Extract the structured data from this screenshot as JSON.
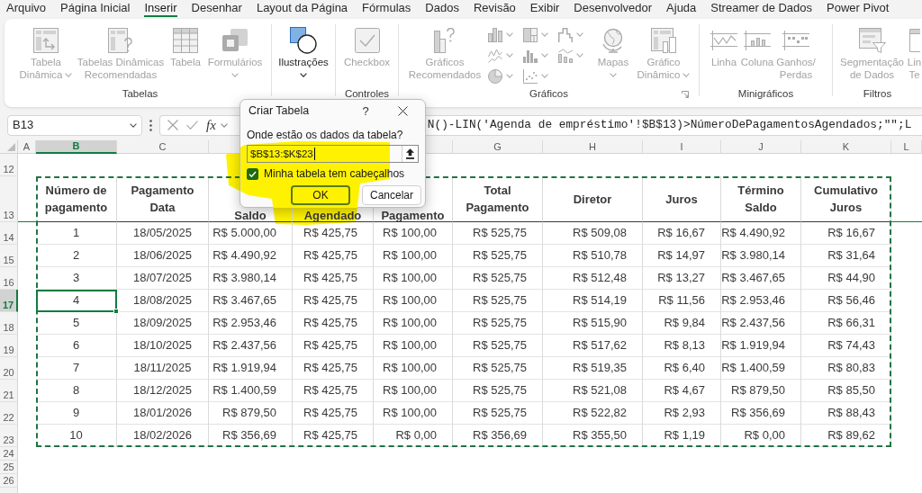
{
  "ribbon_tabs": [
    {
      "label": "Arquivo",
      "selected": false
    },
    {
      "label": "Página Inicial",
      "selected": false
    },
    {
      "label": "Inserir",
      "selected": true
    },
    {
      "label": "Desenhar",
      "selected": false
    },
    {
      "label": "Layout da Página",
      "selected": false
    },
    {
      "label": "Fórmulas",
      "selected": false
    },
    {
      "label": "Dados",
      "selected": false
    },
    {
      "label": "Revisão",
      "selected": false
    },
    {
      "label": "Exibir",
      "selected": false
    },
    {
      "label": "Desenvolvedor",
      "selected": false
    },
    {
      "label": "Ajuda",
      "selected": false
    },
    {
      "label": "Streamer de Dados",
      "selected": false
    },
    {
      "label": "Power Pivot",
      "selected": false
    }
  ],
  "ribbon_groups": [
    {
      "label": "Tabelas",
      "items": [
        {
          "kind": "large",
          "lines": [
            "Tabela",
            "Dinâmica"
          ],
          "disabled": true,
          "dropdown": true
        },
        {
          "kind": "large",
          "lines": [
            "Tabelas Dinâmicas",
            "Recomendadas"
          ],
          "disabled": true,
          "dropdown": false
        },
        {
          "kind": "large",
          "lines": [
            "Tabela"
          ],
          "disabled": true,
          "dropdown": false
        },
        {
          "kind": "large",
          "lines": [
            "Formulários"
          ],
          "disabled": true,
          "dropdown": true
        }
      ]
    },
    {
      "items": [
        {
          "kind": "large",
          "lines": [
            "Ilustrações"
          ],
          "disabled": false,
          "dropdown": true
        }
      ]
    },
    {
      "label": "Controles",
      "items": [
        {
          "kind": "large",
          "lines": [
            "Checkbox"
          ],
          "disabled": true,
          "dropdown": false
        }
      ]
    },
    {
      "label": "Gráficos",
      "launcher": true,
      "items": [
        {
          "kind": "large",
          "lines": [
            "Gráficos",
            "Recomendados"
          ],
          "disabled": true,
          "dropdown": false
        },
        {
          "kind": "chart_grid",
          "buttons": [
            {
              "disabled": true,
              "dropdown": true
            },
            {
              "disabled": true,
              "dropdown": true
            },
            {
              "disabled": true,
              "dropdown": true
            },
            {
              "disabled": true,
              "dropdown": true
            },
            {
              "disabled": true,
              "dropdown": true
            },
            {
              "disabled": true,
              "dropdown": true
            },
            {
              "disabled": true,
              "dropdown": true
            },
            {
              "disabled": true,
              "dropdown": true
            }
          ]
        },
        {
          "kind": "large",
          "lines": [
            "Mapas"
          ],
          "disabled": true,
          "dropdown": true
        },
        {
          "kind": "large",
          "lines": [
            "Gráfico",
            "Dinâmico"
          ],
          "disabled": true,
          "dropdown": true
        }
      ]
    },
    {
      "label": "Minigráficos",
      "items": [
        {
          "kind": "large",
          "lines": [
            "Linha"
          ],
          "disabled": true,
          "dropdown": false
        },
        {
          "kind": "large",
          "lines": [
            "Coluna"
          ],
          "disabled": true,
          "dropdown": false
        },
        {
          "kind": "large",
          "lines": [
            "Ganhos/",
            "Perdas"
          ],
          "disabled": true,
          "dropdown": false
        }
      ]
    },
    {
      "label": "Filtros",
      "items": [
        {
          "kind": "large",
          "lines": [
            "Segmentação",
            "de Dados"
          ],
          "disabled": true,
          "dropdown": false
        },
        {
          "kind": "large",
          "lines": [
            "Lin",
            "Te"
          ],
          "disabled": true,
          "dropdown": false
        }
      ]
    }
  ],
  "formula_bar": {
    "name_box": "B13",
    "function_label": "fx",
    "formula": "N()-LIN('Agenda de empréstimo'!$B$13)>NúmeroDePagamentosAgendados;\"\";L"
  },
  "sheet": {
    "column_headers_left": [
      {
        "label": "A",
        "selected": false
      },
      {
        "label": "B",
        "selected": true
      },
      {
        "label": "C",
        "selected": false
      },
      {
        "selected": false
      }
    ],
    "column_headers_right": [
      {
        "selected": false
      },
      {
        "label": "G",
        "selected": false
      },
      {
        "label": "H",
        "selected": false
      },
      {
        "label": "I",
        "selected": false
      },
      {
        "label": "J",
        "selected": false
      },
      {
        "label": "K",
        "selected": false
      },
      {
        "label": "L",
        "selected": false
      }
    ],
    "row_headers": [
      {
        "label": "12",
        "selected": false
      },
      {
        "label": "13",
        "selected": false
      },
      {
        "label": "14",
        "selected": false
      },
      {
        "label": "15",
        "selected": false
      },
      {
        "label": "16",
        "selected": false
      },
      {
        "label": "17",
        "selected": true
      },
      {
        "label": "18",
        "selected": false
      },
      {
        "label": "19",
        "selected": false
      },
      {
        "label": "20",
        "selected": false
      },
      {
        "label": "21",
        "selected": false
      },
      {
        "label": "22",
        "selected": false
      },
      {
        "label": "23",
        "selected": false
      },
      {
        "label": "24",
        "selected": false
      },
      {
        "label": "25",
        "selected": false
      },
      {
        "label": "26",
        "selected": false
      }
    ]
  },
  "table": {
    "columns": [
      {
        "lines": [
          "Número de",
          "pagamento"
        ],
        "kind": "full"
      },
      {
        "lines": [
          "Pagamento",
          "Data"
        ],
        "kind": "full"
      },
      {
        "lines": [
          "Saldo"
        ],
        "kind": "partly_hidden"
      },
      {
        "lines": [
          "Agendado"
        ],
        "kind": "partly_hidden"
      },
      {
        "lines": [
          "Pagamento"
        ],
        "kind": "partly_hidden"
      },
      {
        "lines": [
          "Total",
          "Pagamento"
        ],
        "kind": "full"
      },
      {
        "lines": [
          "Diretor"
        ],
        "kind": "full"
      },
      {
        "lines": [
          "Juros"
        ],
        "kind": "full"
      },
      {
        "lines": [
          "Término",
          "Saldo"
        ],
        "kind": "full"
      },
      {
        "lines": [
          "Cumulativo",
          "Juros"
        ],
        "kind": "full"
      }
    ],
    "rows": [
      [
        "1",
        "18/05/2025",
        "R$ 5.000,00",
        "R$ 425,75",
        "R$ 100,00",
        "R$ 525,75",
        "R$ 509,08",
        "R$ 16,67",
        "R$ 4.490,92",
        "R$ 16,67"
      ],
      [
        "2",
        "18/06/2025",
        "R$ 4.490,92",
        "R$ 425,75",
        "R$ 100,00",
        "R$ 525,75",
        "R$ 510,78",
        "R$ 14,97",
        "R$ 3.980,14",
        "R$ 31,64"
      ],
      [
        "3",
        "18/07/2025",
        "R$ 3.980,14",
        "R$ 425,75",
        "R$ 100,00",
        "R$ 525,75",
        "R$ 512,48",
        "R$ 13,27",
        "R$ 3.467,65",
        "R$ 44,90"
      ],
      [
        "4",
        "18/08/2025",
        "R$ 3.467,65",
        "R$ 425,75",
        "R$ 100,00",
        "R$ 525,75",
        "R$ 514,19",
        "R$ 11,56",
        "R$ 2.953,46",
        "R$ 56,46"
      ],
      [
        "5",
        "18/09/2025",
        "R$ 2.953,46",
        "R$ 425,75",
        "R$ 100,00",
        "R$ 525,75",
        "R$ 515,90",
        "R$ 9,84",
        "R$ 2.437,56",
        "R$ 66,31"
      ],
      [
        "6",
        "18/10/2025",
        "R$ 2.437,56",
        "R$ 425,75",
        "R$ 100,00",
        "R$ 525,75",
        "R$ 517,62",
        "R$ 8,13",
        "R$ 1.919,94",
        "R$ 74,43"
      ],
      [
        "7",
        "18/11/2025",
        "R$ 1.919,94",
        "R$ 425,75",
        "R$ 100,00",
        "R$ 525,75",
        "R$ 519,35",
        "R$ 6,40",
        "R$ 1.400,59",
        "R$ 80,83"
      ],
      [
        "8",
        "18/12/2025",
        "R$ 1.400,59",
        "R$ 425,75",
        "R$ 100,00",
        "R$ 525,75",
        "R$ 521,08",
        "R$ 4,67",
        "R$ 879,50",
        "R$ 85,50"
      ],
      [
        "9",
        "18/01/2026",
        "R$ 879,50",
        "R$ 425,75",
        "R$ 100,00",
        "R$ 525,75",
        "R$ 522,82",
        "R$ 2,93",
        "R$ 356,69",
        "R$ 88,43"
      ],
      [
        "10",
        "18/02/2026",
        "R$ 356,69",
        "R$ 425,75",
        "R$ 0,00",
        "R$ 356,69",
        "R$ 355,50",
        "R$ 1,19",
        "R$ 0,00",
        "R$ 89,62"
      ]
    ]
  },
  "dialog": {
    "title": "Criar Tabela",
    "help_label": "?",
    "prompt": "Onde estão os dados da tabela?",
    "range": "$B$13:$K$23",
    "checkbox": {
      "label": "Minha tabela tem cabeçalhos",
      "checked": true
    },
    "buttons": [
      {
        "label": "OK",
        "default": true
      },
      {
        "label": "Cancelar",
        "default": false
      }
    ]
  }
}
